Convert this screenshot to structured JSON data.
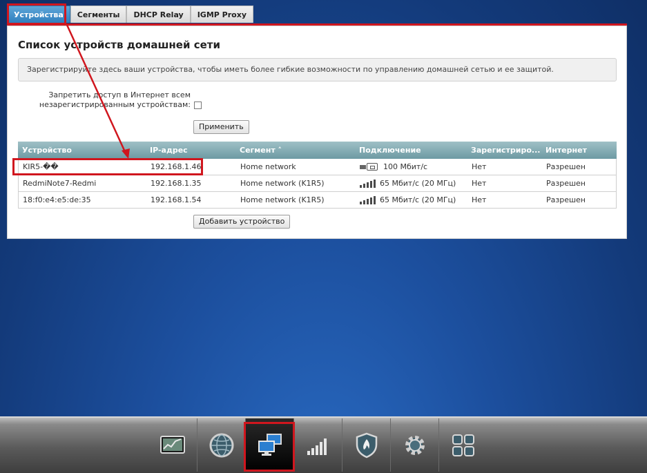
{
  "tabs": [
    {
      "label": "Устройства",
      "active": true
    },
    {
      "label": "Сегменты",
      "active": false
    },
    {
      "label": "DHCP Relay",
      "active": false
    },
    {
      "label": "IGMP Proxy",
      "active": false
    }
  ],
  "panel": {
    "title": "Список устройств домашней сети",
    "info": "Зарегистрируйте здесь ваши устройства, чтобы иметь более гибкие возможности по управлению домашней сетью и ее защитой.",
    "deny_label_line1": "Запретить доступ в Интернет всем",
    "deny_label_line2": "незарегистрированным устройствам:",
    "deny_checked": false,
    "apply_label": "Применить",
    "add_label": "Добавить устройство"
  },
  "table": {
    "headers": [
      "Устройство",
      "IP-адрес",
      "Сегмент ˄",
      "Подключение",
      "Зарегистриро...",
      "Интернет"
    ],
    "rows": [
      {
        "device": "KIR5-��",
        "ip": "192.168.1.46",
        "segment": "Home network",
        "conn_type": "ethernet-icon",
        "conn": "100 Мбит/с",
        "registered": "Нет",
        "internet": "Разрешен"
      },
      {
        "device": "RedmiNote7-Redmi",
        "ip": "192.168.1.35",
        "segment": "Home network (K1R5)",
        "conn_type": "wifi-bars-icon",
        "conn": "65 Мбит/с (20 МГц)",
        "registered": "Нет",
        "internet": "Разрешен"
      },
      {
        "device": "18:f0:e4:e5:de:35",
        "ip": "192.168.1.54",
        "segment": "Home network (K1R5)",
        "conn_type": "wifi-bars-icon",
        "conn": "65 Мбит/с (20 МГц)",
        "registered": "Нет",
        "internet": "Разрешен"
      }
    ]
  },
  "bottom_nav": [
    {
      "icon": "monitor-chart-icon",
      "active": false
    },
    {
      "icon": "globe-icon",
      "active": false
    },
    {
      "icon": "network-computers-icon",
      "active": true
    },
    {
      "icon": "signal-bars-icon",
      "active": false
    },
    {
      "icon": "shield-fire-icon",
      "active": false
    },
    {
      "icon": "gear-icon",
      "active": false
    },
    {
      "icon": "apps-grid-icon",
      "active": false
    }
  ],
  "colors": {
    "highlight": "#d0161e",
    "tab_active": "#2f7fbe",
    "table_header": "#7fa8b0"
  }
}
